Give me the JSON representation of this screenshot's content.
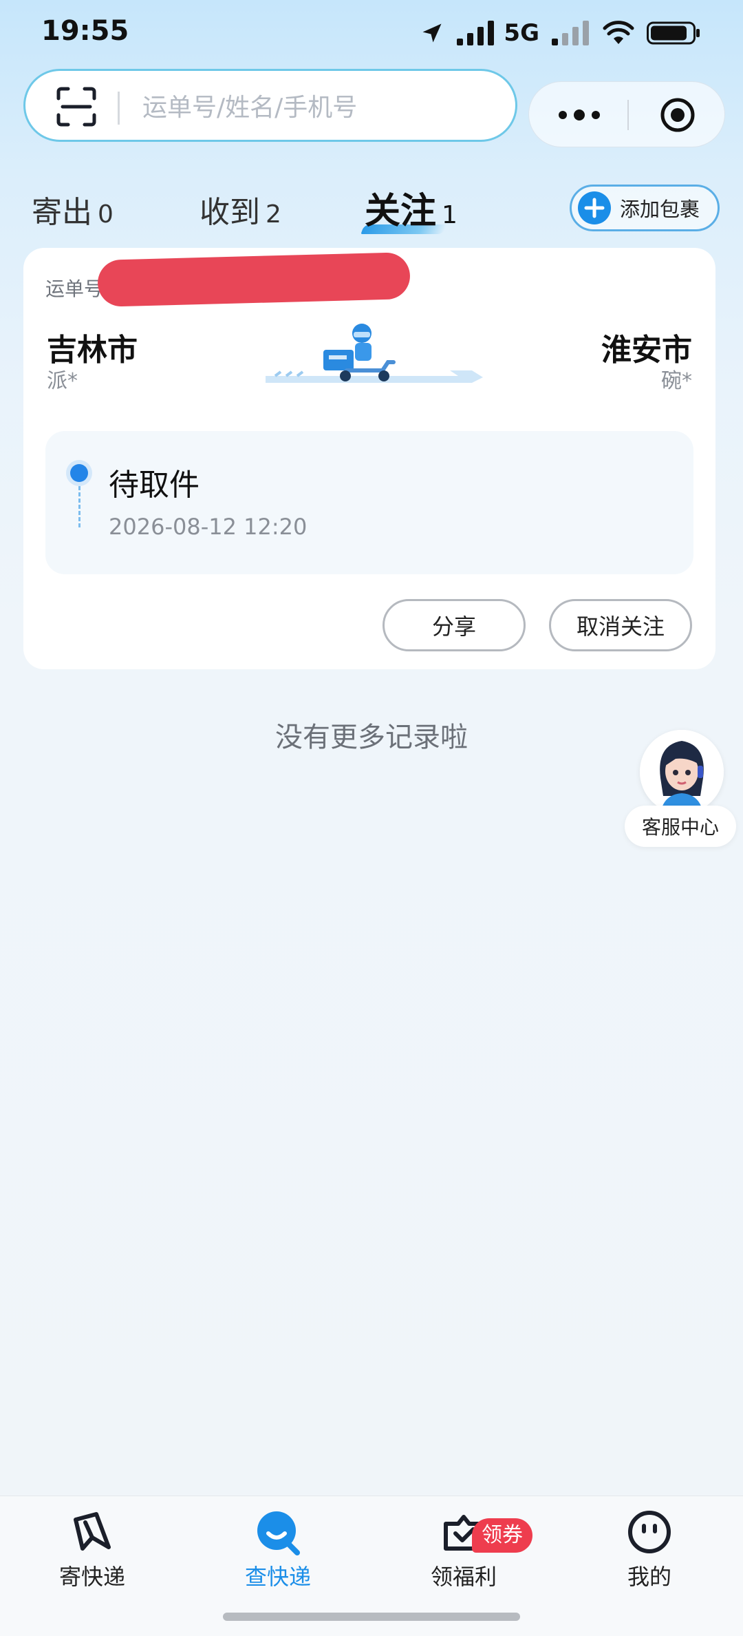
{
  "status_bar": {
    "time": "19:55",
    "network": "5G",
    "icons": [
      "location-arrow-icon",
      "signal-icon",
      "signal-weak-icon",
      "wifi-icon",
      "battery-icon"
    ]
  },
  "search": {
    "placeholder": "运单号/姓名/手机号",
    "scan_icon": "scan-icon"
  },
  "capsule": {
    "more_icon": "more-dots-icon",
    "close_icon": "target-icon"
  },
  "tabs": [
    {
      "label": "寄出",
      "count": "0",
      "active": false
    },
    {
      "label": "收到",
      "count": "2",
      "active": false
    },
    {
      "label": "关注",
      "count": "1",
      "active": true
    }
  ],
  "add_package": {
    "label": "添加包裹",
    "icon": "plus-circle-icon"
  },
  "package": {
    "waybill_label": "运单号:",
    "from_city": "吉林市",
    "from_person": "派*",
    "to_city": "淮安市",
    "to_person": "碗*",
    "status": "待取件",
    "status_time": "2026-08-12 12:20",
    "share_label": "分享",
    "unfollow_label": "取消关注"
  },
  "no_more_text": "没有更多记录啦",
  "customer_service": {
    "label": "客服中心"
  },
  "bottom_nav": [
    {
      "label": "寄快递",
      "icon": "send-package-icon",
      "active": false
    },
    {
      "label": "查快递",
      "icon": "search-package-icon",
      "active": true
    },
    {
      "label": "领福利",
      "icon": "coupon-gift-icon",
      "active": false,
      "badge": "领券"
    },
    {
      "label": "我的",
      "icon": "profile-face-icon",
      "active": false
    }
  ],
  "colors": {
    "accent": "#1b8ee8",
    "badge": "#ee3d4e",
    "redaction": "#e84657"
  }
}
